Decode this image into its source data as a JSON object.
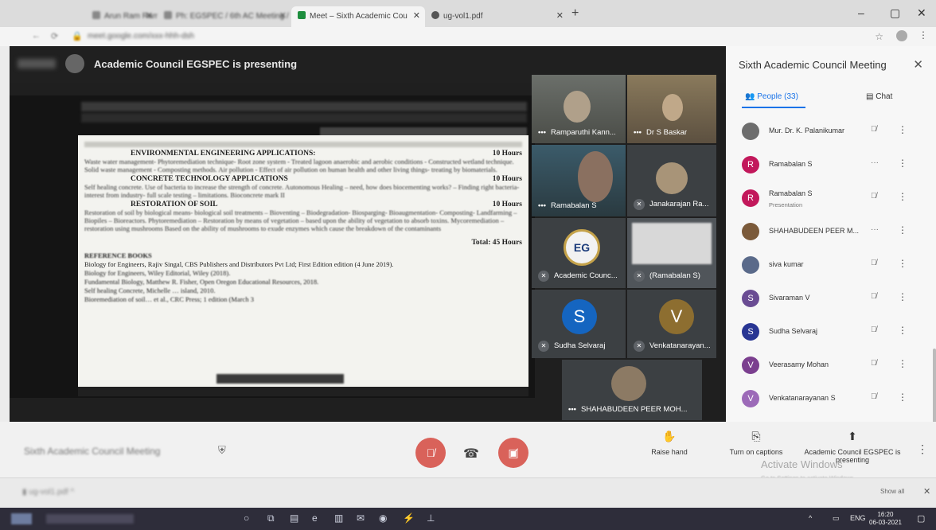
{
  "browser": {
    "tabs": [
      {
        "label": "Arun Ram Ram Ram",
        "active": false
      },
      {
        "label": "Ph: EGSPEC / 6th AC Meeting / Files",
        "active": false
      },
      {
        "label": "Meet – Sixth Academic Cou",
        "active": true
      },
      {
        "label": "ug-vol1.pdf",
        "active": false
      }
    ],
    "url": "meet.google.com/xxx-hhh-dsh"
  },
  "presenting_banner": "Academic Council EGSPEC is presenting",
  "shared_doc": {
    "units": [
      {
        "title": "ENVIRONMENTAL ENGINEERING APPLICATIONS:",
        "hours": "10 Hours",
        "body": "Waste water management- Phytoremediation technique- Root zone system - Treated lagoon anaerobic and aerobic conditions - Constructed wetland technique. Solid waste management - Composting methods. Air pollution - Effect of air pollution on human health and other living things- treating by biomaterials."
      },
      {
        "title": "CONCRETE TECHNOLOGY APPLICATIONS",
        "hours": "10 Hours",
        "body": "Self healing concrete. Use of bacteria to increase the strength of concrete. Autonomous Healing – need, how does biocementing works? – Finding right bacteria- interest from industry- full scale testing – limitations. Bioconcrete mark II"
      },
      {
        "title": "RESTORATION OF SOIL",
        "hours": "10 Hours",
        "body": "Restoration of soil by biological means- biological soil treatments – Bioventing – Biodegradation- Biosparging- Bioaugmentation- Composting- Landfarming – Biopiles – Bioreactors. Phytoremediation – Restoration by means of vegetation – based upon the ability of vegetation to absorb toxins. Mycoremediation – restoration using mushrooms Based on the ability of mushrooms to exude enzymes which cause the breakdown of the contaminants"
      }
    ],
    "total": "Total: 45 Hours",
    "references_heading": "REFERENCE BOOKS",
    "references": [
      "Biology for Engineers, Rajiv Singal, CBS Publishers and Distributors Pvt Ltd; First Edition edition (4 June 2019).",
      "Biology for Engineers, Wiley Editorial, Wiley (2018).",
      "Fundamental Biology, Matthew R. Fisher, Open Oregon Educational Resources, 2018.",
      "Self healing Concrete, Michelle … island, 2010.",
      "Bioremediation of soil… et al., CRC Press; 1 edition (March 3"
    ]
  },
  "tiles": [
    {
      "name": "Ramparuthi Kann..."
    },
    {
      "name": "Dr S Baskar"
    },
    {
      "name": "Ramabalan S"
    },
    {
      "name": "Janakarajan Ra..."
    },
    {
      "name": "Academic Counc..."
    },
    {
      "name": "(Ramabalan S)"
    },
    {
      "name": "Sudha Selvaraj",
      "initial": "S",
      "color": "#1565c0"
    },
    {
      "name": "Venkatanarayan...",
      "initial": "V",
      "color": "#8d6e30"
    },
    {
      "name": "SHAHABUDEEN PEER MOH..."
    }
  ],
  "panel": {
    "title": "Sixth Academic Council Meeting",
    "people_tab": "People (33)",
    "chat_tab": "Chat",
    "people": [
      {
        "name": "Mur. Dr. K. Palanikumar",
        "initial": "",
        "color": "#6d6d6d"
      },
      {
        "name": "Ramabalan S",
        "initial": "R",
        "color": "#c2185b"
      },
      {
        "name": "Ramabalan S",
        "sub": "Presentation",
        "initial": "R",
        "color": "#c2185b"
      },
      {
        "name": "SHAHABUDEEN PEER M...",
        "initial": "",
        "color": "#7b5a3a"
      },
      {
        "name": "siva kumar",
        "initial": "",
        "color": "#5a6a8a"
      },
      {
        "name": "Sivaraman V",
        "initial": "S",
        "color": "#6a4c93"
      },
      {
        "name": "Sudha Selvaraj",
        "initial": "S",
        "color": "#283593"
      },
      {
        "name": "Veerasamy Mohan",
        "initial": "V",
        "color": "#7b3f8f"
      },
      {
        "name": "Venkatanarayanan S",
        "initial": "V",
        "color": "#9c6ab8"
      }
    ]
  },
  "controls": {
    "meeting_name": "Sixth Academic Council Meeting",
    "raise_hand": "Raise hand",
    "captions": "Turn on captions",
    "presenting_label": "Academic Council EGSPEC is presenting"
  },
  "watermark": {
    "title": "Activate Windows",
    "sub": "Go to Settings to activate Windows."
  },
  "downloads": {
    "item": "ug-vol1.pdf",
    "show_all": "Show all"
  },
  "taskbar": {
    "search": "Type here to search",
    "lang": "ENG",
    "time": "16:20",
    "date": "06-03-2021"
  }
}
